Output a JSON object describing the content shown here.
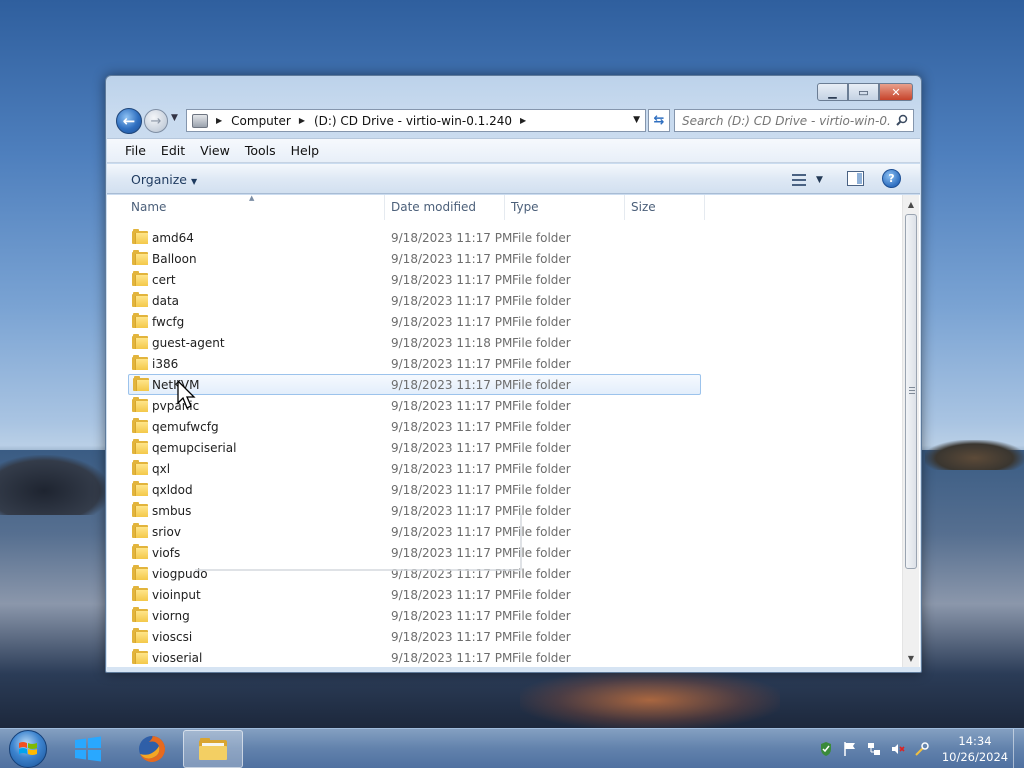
{
  "window": {
    "minimize_glyph": "▁",
    "maximize_glyph": "▭",
    "close_glyph": "✕"
  },
  "navigation": {
    "back_glyph": "←",
    "forward_glyph": "→",
    "breadcrumbs": [
      "Computer",
      "(D:) CD Drive - virtio-win-0.1.240"
    ],
    "search_placeholder": "Search (D:) CD Drive - virtio-win-0.1.2..."
  },
  "menu": {
    "items": [
      "File",
      "Edit",
      "View",
      "Tools",
      "Help"
    ]
  },
  "commandbar": {
    "organize_label": "Organize",
    "help_glyph": "?"
  },
  "columns": {
    "name": "Name",
    "date": "Date modified",
    "type": "Type",
    "size": "Size"
  },
  "files": [
    {
      "name": "amd64",
      "date": "9/18/2023 11:17 PM",
      "type": "File folder"
    },
    {
      "name": "Balloon",
      "date": "9/18/2023 11:17 PM",
      "type": "File folder"
    },
    {
      "name": "cert",
      "date": "9/18/2023 11:17 PM",
      "type": "File folder"
    },
    {
      "name": "data",
      "date": "9/18/2023 11:17 PM",
      "type": "File folder"
    },
    {
      "name": "fwcfg",
      "date": "9/18/2023 11:17 PM",
      "type": "File folder"
    },
    {
      "name": "guest-agent",
      "date": "9/18/2023 11:18 PM",
      "type": "File folder"
    },
    {
      "name": "i386",
      "date": "9/18/2023 11:17 PM",
      "type": "File folder"
    },
    {
      "name": "NetKVM",
      "date": "9/18/2023 11:17 PM",
      "type": "File folder"
    },
    {
      "name": "pvpanic",
      "date": "9/18/2023 11:17 PM",
      "type": "File folder"
    },
    {
      "name": "qemufwcfg",
      "date": "9/18/2023 11:17 PM",
      "type": "File folder"
    },
    {
      "name": "qemupciserial",
      "date": "9/18/2023 11:17 PM",
      "type": "File folder"
    },
    {
      "name": "qxl",
      "date": "9/18/2023 11:17 PM",
      "type": "File folder"
    },
    {
      "name": "qxldod",
      "date": "9/18/2023 11:17 PM",
      "type": "File folder"
    },
    {
      "name": "smbus",
      "date": "9/18/2023 11:17 PM",
      "type": "File folder"
    },
    {
      "name": "sriov",
      "date": "9/18/2023 11:17 PM",
      "type": "File folder"
    },
    {
      "name": "viofs",
      "date": "9/18/2023 11:17 PM",
      "type": "File folder"
    },
    {
      "name": "viogpudo",
      "date": "9/18/2023 11:17 PM",
      "type": "File folder"
    },
    {
      "name": "vioinput",
      "date": "9/18/2023 11:17 PM",
      "type": "File folder"
    },
    {
      "name": "viorng",
      "date": "9/18/2023 11:17 PM",
      "type": "File folder"
    },
    {
      "name": "vioscsi",
      "date": "9/18/2023 11:17 PM",
      "type": "File folder"
    },
    {
      "name": "vioserial",
      "date": "9/18/2023 11:17 PM",
      "type": "File folder"
    }
  ],
  "hovered_row_index": 7,
  "taskbar": {
    "time": "14:34",
    "date": "10/26/2024"
  }
}
